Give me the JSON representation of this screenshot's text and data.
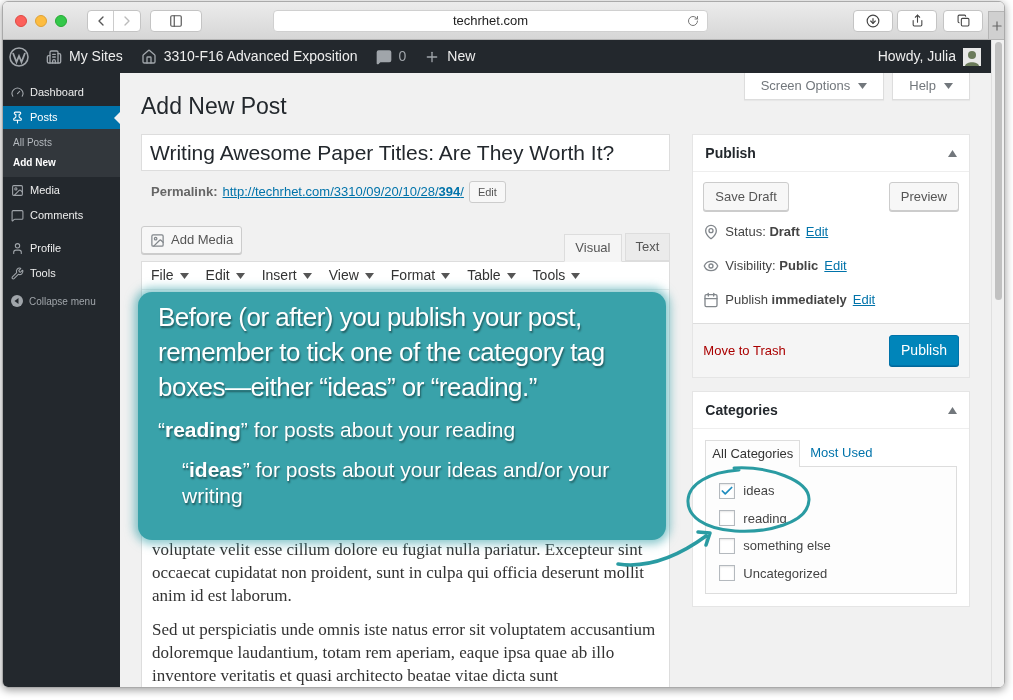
{
  "browser": {
    "address": "techrhet.com"
  },
  "admin_bar": {
    "items": [
      {
        "label": "My Sites"
      },
      {
        "label": "3310-F16 Advanced Exposition"
      },
      {
        "label": "0"
      },
      {
        "label": "New"
      }
    ],
    "greeting": "Howdy, Julia"
  },
  "sidebar": {
    "items": [
      {
        "label": "Dashboard",
        "selected": false
      },
      {
        "label": "Posts",
        "selected": true,
        "children": [
          {
            "label": "All Posts",
            "selected": false
          },
          {
            "label": "Add New",
            "selected": true
          }
        ]
      },
      {
        "label": "Media",
        "selected": false
      },
      {
        "label": "Comments",
        "selected": false
      },
      {
        "label": "Profile",
        "selected": false
      },
      {
        "label": "Tools",
        "selected": false
      }
    ],
    "collapse": "Collapse menu"
  },
  "screen_tabs": [
    "Screen Options",
    "Help"
  ],
  "page_title": "Add New Post",
  "post_title": "Writing Awesome Paper Titles: Are They Worth It?",
  "permalink": {
    "label": "Permalink:",
    "url": "http://techrhet.com/3310/09/20/10/28/**394**/",
    "button": "Edit"
  },
  "add_media": "Add Media",
  "editor_tabs": [
    {
      "label": "Visual",
      "selected": true
    },
    {
      "label": "Text",
      "selected": false
    }
  ],
  "menu": [
    "File",
    "Edit",
    "Insert",
    "View",
    "Format",
    "Table",
    "Tools"
  ],
  "paragraphs": [
    "voluptate velit esse cillum dolore eu fugiat nulla pariatur. Excepteur sint occaecat cupidatat non proident, sunt in culpa qui officia deserunt mollit anim id est laborum.",
    "Sed ut perspiciatis unde omnis iste natus error sit voluptatem accusantium doloremque laudantium, totam rem aperiam, eaque ipsa quae ab illo inventore veritatis et quasi architecto beatae vitae dicta sunt"
  ],
  "callout": {
    "text": "Before (or after) you publish your post, remember to tick one of the category tag boxes—either “ideas” or “reading.”",
    "notes": [
      "“**reading**” for posts about your reading",
      "“**ideas**” for posts about your ideas and/or your writing"
    ]
  },
  "publish": {
    "title": "Publish",
    "save_draft": "Save Draft",
    "preview": "Preview",
    "rows": [
      {
        "text": "Status: **Draft**",
        "link": "Edit"
      },
      {
        "text": "Visibility: **Public**",
        "link": "Edit"
      },
      {
        "text": "Publish **immediately**",
        "link": "Edit"
      }
    ],
    "trash": "Move to Trash",
    "publish_button": "Publish"
  },
  "categories": {
    "title": "Categories",
    "tabs": [
      {
        "label": "All Categories",
        "selected": true
      },
      {
        "label": "Most Used",
        "selected": false
      }
    ],
    "items": [
      {
        "label": "ideas",
        "checked": true
      },
      {
        "label": "reading",
        "checked": false
      },
      {
        "label": "something else",
        "checked": false
      },
      {
        "label": "Uncategorized",
        "checked": false
      }
    ]
  }
}
